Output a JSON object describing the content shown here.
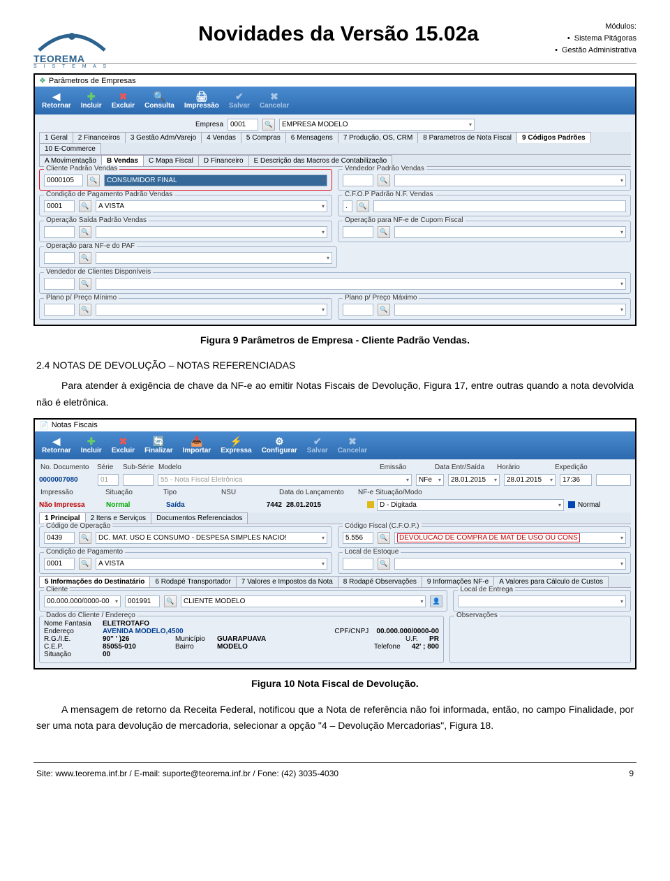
{
  "header": {
    "title": "Novidades da Versão 15.02a",
    "modules_label": "Módulos:",
    "modules": [
      "Sistema Pitágoras",
      "Gestão Administrativa"
    ],
    "logo_name": "TEOREMA",
    "logo_sub": "S I S T E M A S"
  },
  "fig9": {
    "caption": "Figura 9 Parâmetros de Empresa - Cliente Padrão Vendas.",
    "window_title": "Parâmetros de Empresas",
    "toolbar": {
      "retornar": "Retornar",
      "incluir": "Incluir",
      "excluir": "Excluir",
      "consulta": "Consulta",
      "impressao": "Impressão",
      "salvar": "Salvar",
      "cancelar": "Cancelar"
    },
    "empresa_label": "Empresa",
    "empresa_code": "0001",
    "empresa_name": "EMPRESA MODELO",
    "tabs1": [
      "1 Geral",
      "2 Financeiros",
      "3 Gestão Adm/Varejo",
      "4 Vendas",
      "5 Compras",
      "6 Mensagens",
      "7 Produção, OS, CRM",
      "8 Parametros de Nota Fiscal",
      "9 Códigos Padrões",
      "10 E-Commerce"
    ],
    "tabs1_active": 8,
    "tabs2": [
      "A Movimentação",
      "B Vendas",
      "C Mapa Fiscal",
      "D Financeiro",
      "E Descrição das Macros de Contabilização"
    ],
    "tabs2_active": 1,
    "fs_cliente": "Cliente Padrão Vendas",
    "cliente_code": "0000105",
    "cliente_name": "CONSUMIDOR FINAL",
    "fs_vendedor": "Vendedor Padrão Vendas",
    "fs_condpag": "Condição de Pagamento Padrão Vendas",
    "condpag_code": "0001",
    "condpag_name": "A VISTA",
    "fs_cfop": "C.F.O.P Padrão N.F. Vendas",
    "fs_opsaida": "Operação Saída Padrão Vendas",
    "fs_opnfe_cupom": "Operação para NF-e de Cupom Fiscal",
    "fs_opnfe_paf": "Operação para NF-e do PAF",
    "fs_vend_disp": "Vendedor de Clientes Disponíveis",
    "fs_plano_min": "Plano p/ Preço Mínimo",
    "fs_plano_max": "Plano p/ Preço Máximo"
  },
  "section24": {
    "title": "2.4 NOTAS DE DEVOLUÇÃO – NOTAS REFERENCIADAS",
    "paragraph": "Para atender à exigência de chave da NF-e ao emitir Notas Fiscais de Devolução, Figura 17, entre outras quando a nota devolvida não é eletrônica."
  },
  "fig10": {
    "caption": "Figura 10 Nota Fiscal de Devolução.",
    "window_title": "Notas Fiscais",
    "toolbar": {
      "retornar": "Retornar",
      "incluir": "Incluir",
      "excluir": "Excluir",
      "finalizar": "Finalizar",
      "importar": "Importar",
      "expressa": "Expressa",
      "configurar": "Configurar",
      "salvar": "Salvar",
      "cancelar": "Cancelar"
    },
    "gridhdr": {
      "doc": "No. Documento",
      "serie": "Série",
      "subserie": "Sub-Série",
      "modelo": "Modelo",
      "emissao": "Emissão",
      "data_es": "Data Entr/Saída",
      "horario": "Horário",
      "exped": "Expedição"
    },
    "doc_no": "0000007080",
    "serie": "01",
    "modelo": "55 - Nota Fiscal Eletrônica",
    "emissao_tipo": "NFe",
    "emissao_data": "28.01.2015",
    "data_es": "28.01.2015",
    "horario": "17:36",
    "row2hdr": {
      "impressao": "Impressão",
      "situacao": "Situação",
      "tipo": "Tipo",
      "nsu": "NSU",
      "data_lanc": "Data do Lançamento",
      "nfe_sit": "NF-e Situação/Modo"
    },
    "impressao": "Não Impressa",
    "situacao": "Normal",
    "tipo": "Saída",
    "nsu": "7442",
    "data_lanc": "28.01.2015",
    "nfe_sit": "D - Digitada",
    "modo": "Normal",
    "tabs1": [
      "1 Principal",
      "2 Itens e Serviços",
      "Documentos Referenciados"
    ],
    "tabs1_active": 0,
    "fs_codop": "Código de Operação",
    "codop_code": "0439",
    "codop_name": "DC. MAT. USO E CONSUMO - DESPESA SIMPLES NACIO!",
    "fs_cfop": "Código Fiscal (C.F.O.P.)",
    "cfop_code": "5.556",
    "cfop_name": "DEVOLUCAO DE COMPRA DE MAT DE USO OU CONS",
    "fs_condpag": "Condição de Pagamento",
    "condpag_code": "0001",
    "condpag_name": "A VISTA",
    "fs_local": "Local de Estoque",
    "tabs2": [
      "5 Informações do Destinatário",
      "6 Rodapé Transportador",
      "7 Valores e Impostos da Nota",
      "8 Rodapé Observações",
      "9 Informações NF-e",
      "A Valores para Cálculo de Custos"
    ],
    "fs_cliente": "Cliente",
    "cliente_cpf": "00.000.000/0000-00",
    "cliente_code": "001991",
    "cliente_name": "CLIENTE MODELO",
    "fs_local_ent": "Local de Entrega",
    "fs_dados": "Dados do Cliente / Endereço",
    "nome_fant_label": "Nome Fantasia",
    "nome_fant": "ELETROTAFO",
    "endereco_label": "Endereço",
    "endereco": "AVENIDA MODELO,4500",
    "rg_label": "R.G./I.E.",
    "rg": "90\"   '    )26",
    "cep_label": "C.E.P.",
    "cep": "85055-010",
    "municipio_label": "Município",
    "municipio": "GUARAPUAVA",
    "bairro_label": "Bairro",
    "bairro": "MODELO",
    "cpfcnpj_label": "CPF/CNPJ",
    "cpfcnpj": "00.000.000/0000-00",
    "uf_label": "U.F.",
    "uf": "PR",
    "tel_label": "Telefone",
    "tel": "42'  ;       800",
    "situacao_label": "Situação",
    "situacao2": "00",
    "fs_obs": "Observações"
  },
  "para2": "A mensagem de retorno da Receita Federal, notificou que a Nota de referência não foi informada, então, no campo Finalidade, por ser uma nota para devolução de mercadoria, selecionar a opção \"4 – Devolução Mercadorias\", Figura 18.",
  "footer": {
    "left": "Site: www.teorema.inf.br / E-mail: suporte@teorema.inf.br / Fone: (42) 3035-4030",
    "right": "9"
  }
}
